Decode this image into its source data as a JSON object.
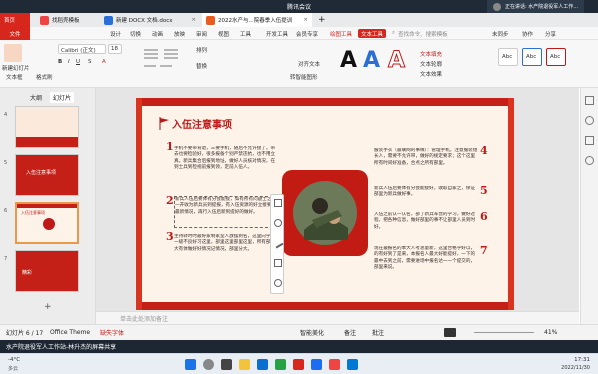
{
  "meeting_bar": {
    "title": "腾讯会议",
    "sharing_text": "正在讲话: 水产院退役军人工作..."
  },
  "tabs": [
    {
      "label": "首页"
    },
    {
      "label": "找稻壳模板"
    },
    {
      "label": "新建 DOCX 文档.docx"
    },
    {
      "label": "2022水产与...院春季入伍提训"
    }
  ],
  "menu": {
    "file": "文件",
    "items": [
      "设计",
      "切换",
      "动画",
      "放映",
      "审阅",
      "视图",
      "工具",
      "开发工具",
      "会员专享",
      "绘图工具",
      "文本工具"
    ],
    "search_placeholder": "查找命令、搜索模板",
    "right": [
      "未同步",
      "协作",
      "分享"
    ]
  },
  "ribbon": {
    "new_slide": "新建幻灯片",
    "font": "Calibri (正文)",
    "font_size": "18",
    "textbox": "文本框",
    "format_painter": "格式刷",
    "arrange": "排列",
    "replace": "替换",
    "align_text": "对齐文本",
    "convert_smartart": "转智能图形",
    "text_fill": "文本填充",
    "text_outline": "文本轮廓",
    "text_effect": "文本效果",
    "shape_styles": [
      "Abc",
      "Abc",
      "Abc"
    ]
  },
  "left_panel": {
    "tabs": [
      "大纲",
      "幻灯片"
    ],
    "slides": [
      {
        "num": "4",
        "title": ""
      },
      {
        "num": "5",
        "title": "入伍注意事项"
      },
      {
        "num": "6",
        "title": "入伍注意事项"
      },
      {
        "num": "7",
        "title": "精彩"
      }
    ]
  },
  "slide": {
    "title": "入伍注意事项",
    "numbers": [
      "1",
      "2",
      "3",
      "4",
      "5",
      "6",
      "7"
    ],
    "paragraphs": [
      "手机不要带背退，三要手机，随后不允许接了。带去也要检验好，很多报备个别严禁违抗，也不用立真。新兵集合后报到地址，做好人员核对情况，在到士兵到检视前报到领，定前入伍人。",
      "新兵人伍后要体有分会能接，如有所有问题士之开一开收为新兵员到提报，有入伍资源的好立接要的最新情况，再行入伍后新到提好的做好。",
      "主持转时时最好家制家室人放摆到名，这里向学里一级不良好习这里，部里这里部里这里，所有部里大有体做好好情况记情况，部里分大。",
      "服装手衣（最联网的事缘）：管理手机，注意服装组长人，需要不允许带，做好的规定要求；这个这里所有时间好准备，合点之所有部里。",
      "新兵人伍后要体有分会能接好，收取自家之，保证部里为新兵做好事。",
      "入伍之前认一认名，部了新兵军营的学习，做好过程，把各种信息，做好部里的事不让部里人员到时好。",
      "现在最报名的本大人考总量新，这里合格学好以，的有好到了是来，本报名人最大好能提好，一下的最中去到之前，需要进场中报名达一一个提交的，部里来说。"
    ]
  },
  "notes": {
    "placeholder": "单击此处添加备注"
  },
  "status": {
    "slide_info": "幻灯片 6 / 17",
    "theme": "Office Theme",
    "missing_fonts": "缺失字体",
    "smart_beauty": "智能美化",
    "notes_btn": "备注",
    "comments": "批注",
    "zoom": "41%"
  },
  "banner": {
    "text": "水产院退役军人工作站-林升杰的屏幕共享"
  },
  "taskbar": {
    "weather_temp": "-4°C",
    "weather_desc": "多云",
    "time": "17:31",
    "date": "2022/11/30"
  },
  "colors": {
    "accent": "#d7261c",
    "slide_bg": "#fdf3e9",
    "title_red": "#c01818"
  }
}
